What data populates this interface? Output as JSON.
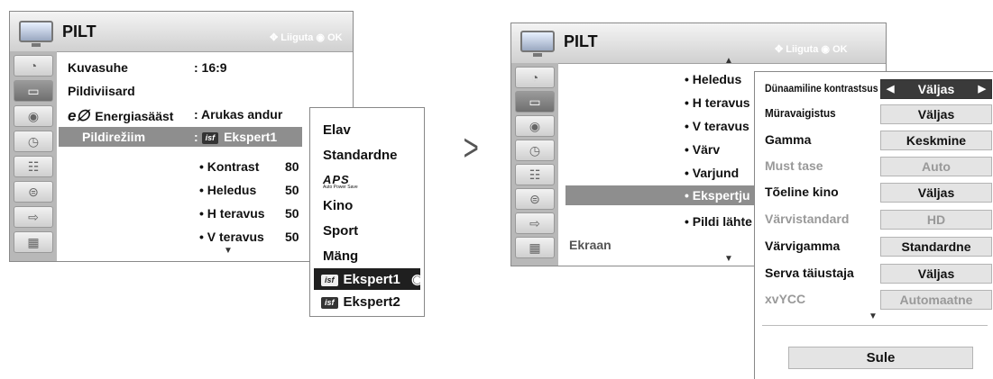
{
  "left": {
    "title": "PILT",
    "hint_move": "Liiguta",
    "hint_ok": "OK",
    "rows": [
      {
        "label": "Kuvasuhe",
        "value": ": 16:9"
      },
      {
        "label": "Pildiviisard",
        "value": ""
      },
      {
        "label": "Energiasääst",
        "value": ": Arukas andur"
      },
      {
        "label": "Pildirežiim",
        "value": ": Ekspert1"
      }
    ],
    "energy_symbol": "e∅",
    "isf_badge": "isf",
    "sub_rows": [
      {
        "label": "• Kontrast",
        "value": "80"
      },
      {
        "label": "• Heledus",
        "value": "50"
      },
      {
        "label": "• H teravus",
        "value": "50"
      },
      {
        "label": "• V teravus",
        "value": "50"
      }
    ],
    "mode_menu": [
      "Elav",
      "Standardne",
      "APS",
      "Kino",
      "Sport",
      "Mäng"
    ],
    "aps_sub": "Auto Power Save",
    "expert_items": [
      "Ekspert1",
      "Ekspert2"
    ]
  },
  "arrow_symbol": ">",
  "right": {
    "title": "PILT",
    "hint_move": "Liiguta",
    "hint_ok": "OK",
    "list": [
      "• Heledus",
      "• H teravus",
      "• V teravus",
      "• Värv",
      "• Varjund",
      "• Ekspertju",
      "• Pildi lähte"
    ],
    "ekraan": "Ekraan",
    "settings": [
      {
        "label": "Dünaamiline kontrastsus",
        "value": "Väljas",
        "dim": false
      },
      {
        "label": "Müravaigistus",
        "value": "Väljas",
        "dim": false
      },
      {
        "label": "Gamma",
        "value": "Keskmine",
        "dim": false
      },
      {
        "label": "Must tase",
        "value": "Auto",
        "dim": true
      },
      {
        "label": "Tõeline kino",
        "value": "Väljas",
        "dim": false
      },
      {
        "label": "Värvistandard",
        "value": "HD",
        "dim": true
      },
      {
        "label": "Värvigamma",
        "value": "Standardne",
        "dim": false
      },
      {
        "label": "Serva täiustaja",
        "value": "Väljas",
        "dim": false
      },
      {
        "label": "xvYCC",
        "value": "Automaatne",
        "dim": true
      }
    ],
    "close_label": "Sule",
    "left_arrow": "◀",
    "right_arrow": "▶"
  }
}
